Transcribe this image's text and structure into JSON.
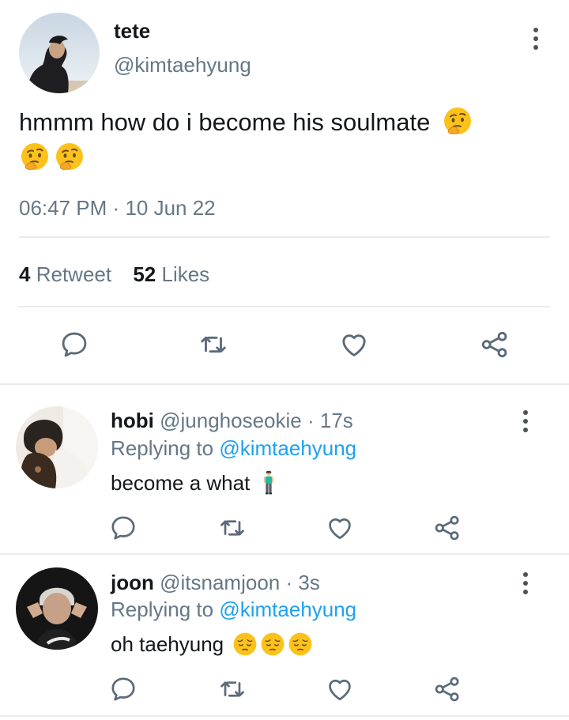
{
  "main_tweet": {
    "display_name": "tete",
    "handle": "@kimtaehyung",
    "text": "hmmm how do i become his soulmate",
    "emojis": [
      "thinking-face",
      "thinking-face",
      "thinking-face"
    ],
    "time": "06:47 PM",
    "separator": "·",
    "date": "10 Jun 22",
    "retweet_count": "4",
    "retweet_label": "Retweet",
    "likes_count": "52",
    "likes_label": "Likes"
  },
  "replies": [
    {
      "display_name": "hobi",
      "handle": "@junghoseokie",
      "age": "· 17s",
      "replying_label": "Replying to",
      "replying_to": "@kimtaehyung",
      "text": "become a what",
      "emojis": [
        "person-standing"
      ]
    },
    {
      "display_name": "joon",
      "handle": "@itsnamjoon",
      "age": "· 3s",
      "replying_label": "Replying to",
      "replying_to": "@kimtaehyung",
      "text": "oh taehyung",
      "emojis": [
        "pensive-face",
        "pensive-face",
        "pensive-face"
      ]
    }
  ],
  "actions": [
    "reply-icon",
    "retweet-icon",
    "like-icon",
    "share-icon"
  ],
  "colors": {
    "link": "#1da1f2",
    "secondary": "#657786",
    "icon": "#5b6a78",
    "divider": "#e8ecef"
  }
}
